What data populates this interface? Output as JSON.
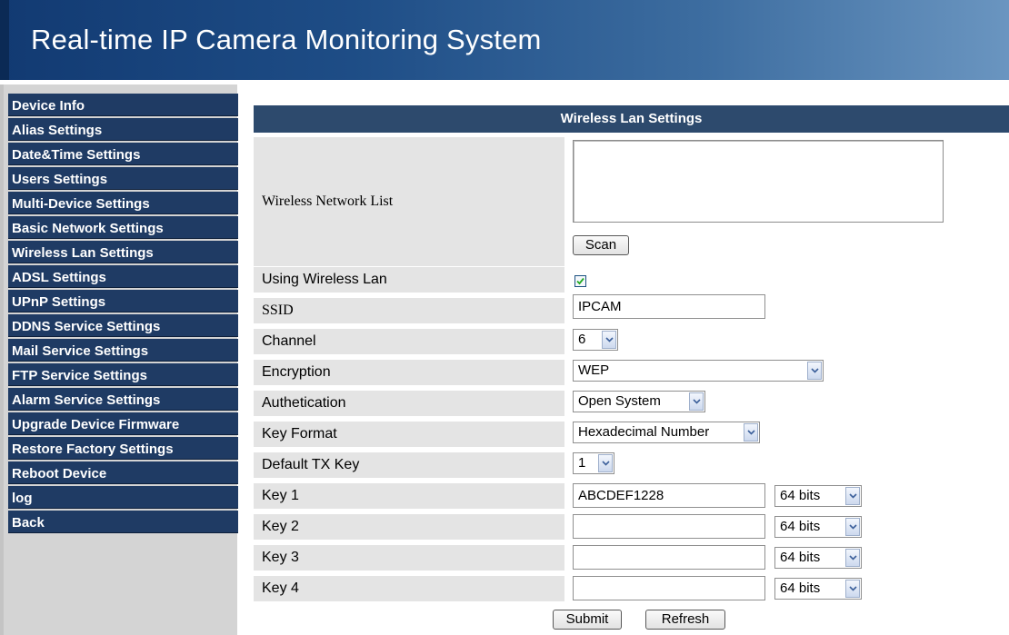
{
  "header": {
    "title": "Real-time IP Camera Monitoring System"
  },
  "sidebar": {
    "items": [
      {
        "label": "Device Info"
      },
      {
        "label": "Alias Settings"
      },
      {
        "label": "Date&Time Settings"
      },
      {
        "label": "Users Settings"
      },
      {
        "label": "Multi-Device Settings"
      },
      {
        "label": "Basic Network Settings"
      },
      {
        "label": "Wireless Lan Settings"
      },
      {
        "label": "ADSL Settings"
      },
      {
        "label": "UPnP Settings"
      },
      {
        "label": "DDNS Service Settings"
      },
      {
        "label": "Mail Service Settings"
      },
      {
        "label": "FTP Service Settings"
      },
      {
        "label": "Alarm Service Settings"
      },
      {
        "label": "Upgrade Device Firmware"
      },
      {
        "label": "Restore Factory Settings"
      },
      {
        "label": "Reboot Device"
      },
      {
        "label": "log"
      },
      {
        "label": "Back"
      }
    ]
  },
  "panel": {
    "title": "Wireless Lan Settings",
    "wireless_list": {
      "label": "Wireless Network List",
      "scan_label": "Scan"
    },
    "using_wireless": {
      "label": "Using Wireless Lan",
      "checked": true
    },
    "ssid": {
      "label": "SSID",
      "value": "IPCAM"
    },
    "channel": {
      "label": "Channel",
      "value": "6"
    },
    "encryption": {
      "label": "Encryption",
      "value": "WEP"
    },
    "authentication": {
      "label": "Authetication",
      "value": "Open System"
    },
    "key_format": {
      "label": "Key Format",
      "value": "Hexadecimal Number"
    },
    "default_tx_key": {
      "label": "Default TX Key",
      "value": "1"
    },
    "keys": [
      {
        "label": "Key 1",
        "value": "ABCDEF1228",
        "bits": "64 bits"
      },
      {
        "label": "Key 2",
        "value": "",
        "bits": "64 bits"
      },
      {
        "label": "Key 3",
        "value": "",
        "bits": "64 bits"
      },
      {
        "label": "Key 4",
        "value": "",
        "bits": "64 bits"
      }
    ],
    "submit_label": "Submit",
    "refresh_label": "Refresh"
  },
  "colors": {
    "header_gradient_start": "#123a72",
    "header_gradient_end": "#6a95c0",
    "menu_item": "#1f3b64",
    "panel_title": "#2d4a6d",
    "label_cell": "#e4e4e4",
    "sidebar_bg": "#d4d4d4"
  }
}
